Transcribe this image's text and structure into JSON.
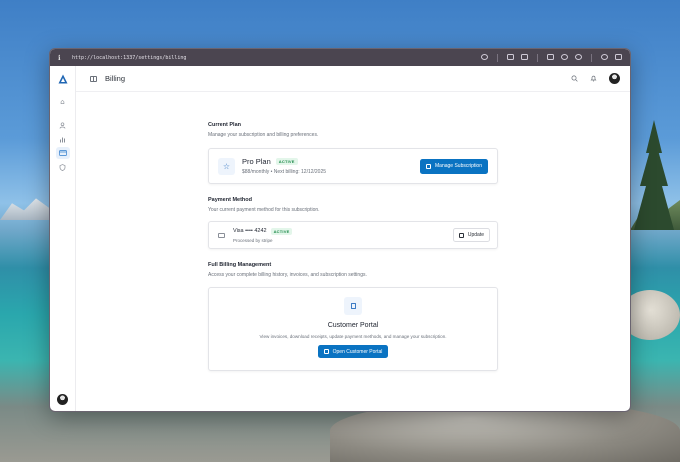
{
  "browser": {
    "url": "http://localhost:1337/settings/billing"
  },
  "header": {
    "title": "Billing"
  },
  "sidebar": {
    "items": [
      {
        "name": "home",
        "icon": "home-icon",
        "active": false
      },
      {
        "name": "users",
        "icon": "user-icon",
        "active": false
      },
      {
        "name": "analytics",
        "icon": "bar-chart-icon",
        "active": false
      },
      {
        "name": "billing",
        "icon": "credit-card-icon",
        "active": true
      },
      {
        "name": "security",
        "icon": "shield-icon",
        "active": false
      }
    ]
  },
  "current_plan": {
    "title": "Current Plan",
    "subtitle": "Manage your subscription and billing preferences.",
    "plan_name": "Pro Plan",
    "status": "ACTIVE",
    "details": "$88/monthly • Next billing: 12/12/2025",
    "button": "Manage Subscription"
  },
  "payment_method": {
    "title": "Payment Method",
    "subtitle": "Your current payment method for this subscription.",
    "card": "Visa •••• 4242",
    "status": "ACTIVE",
    "processor": "Processed by stripe",
    "button": "Update"
  },
  "billing_management": {
    "title": "Full Billing Management",
    "subtitle": "Access your complete billing history, invoices, and subscription settings.",
    "portal_title": "Customer Portal",
    "portal_description": "View invoices, download receipts, update payment methods, and manage your subscription.",
    "button": "Open Customer Portal"
  },
  "colors": {
    "accent": "#0a73c2",
    "active_badge": "#1d8a4a"
  }
}
